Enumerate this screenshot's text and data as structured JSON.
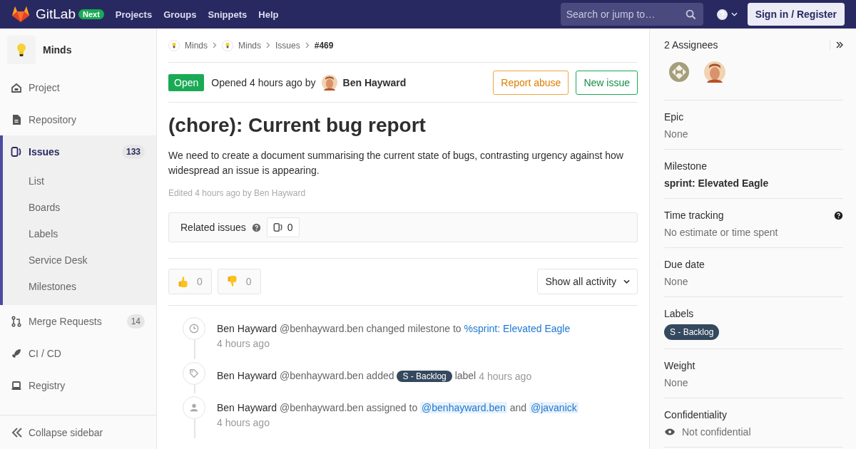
{
  "navbar": {
    "brand": "GitLab",
    "badge": "Next",
    "links": [
      "Projects",
      "Groups",
      "Snippets",
      "Help"
    ],
    "search": {
      "placeholder": "Search or jump to…"
    },
    "sign_in": "Sign in / Register"
  },
  "sidebar": {
    "project": "Minds",
    "items": [
      {
        "label": "Project",
        "selected": false
      },
      {
        "label": "Repository",
        "selected": false
      },
      {
        "label": "Issues",
        "count": "133",
        "selected": true,
        "children": [
          {
            "label": "List",
            "selected": false
          },
          {
            "label": "Boards",
            "selected": false
          },
          {
            "label": "Labels",
            "selected": false
          },
          {
            "label": "Service Desk",
            "selected": false
          },
          {
            "label": "Milestones",
            "selected": false
          }
        ]
      },
      {
        "label": "Merge Requests",
        "count": "14",
        "selected": false
      },
      {
        "label": "CI / CD",
        "selected": false
      },
      {
        "label": "Registry",
        "selected": false
      }
    ],
    "collapse": "Collapse sidebar"
  },
  "breadcrumbs": [
    {
      "text": "Minds",
      "kind": "project"
    },
    {
      "text": "Minds",
      "kind": "project"
    },
    {
      "text": "Issues",
      "kind": "link"
    },
    {
      "text": "#469",
      "kind": "current"
    }
  ],
  "issue": {
    "status": "Open",
    "opened": "Opened 4 hours ago by",
    "author": "Ben Hayward",
    "buttons": [
      {
        "label": "Report abuse",
        "kind": "warning"
      },
      {
        "label": "New issue",
        "kind": "success"
      }
    ],
    "title": "(chore): Current bug report",
    "description": "We need to create a document summarising the current state of bugs, contrasting urgency against how widespread an issue is appearing.",
    "edited": "Edited 4 hours ago by Ben Hayward",
    "related": {
      "label": "Related issues",
      "count": "0"
    },
    "awards": [
      {
        "kind": "thumbsup",
        "count": "0"
      },
      {
        "kind": "thumbsdown",
        "count": "0"
      }
    ],
    "activity_filter": "Show all activity"
  },
  "activity": [
    {
      "kind": "milestone",
      "author": "Ben Hayward",
      "handle": "@benhayward.ben",
      "action": "changed milestone to",
      "link": "%sprint: Elevated Eagle",
      "time": "4 hours ago"
    },
    {
      "kind": "label",
      "author": "Ben Hayward",
      "handle": "@benhayward.ben",
      "action": "added",
      "label": "S - Backlog",
      "suffix": "label",
      "time": "4 hours ago"
    },
    {
      "kind": "assign",
      "author": "Ben Hayward",
      "handle": "@benhayward.ben",
      "action": "assigned to",
      "mentions": [
        "@benhayward.ben",
        "@javanick"
      ],
      "joiner": "and",
      "time": "4 hours ago"
    }
  ],
  "right_sidebar": {
    "assignees_title": "2 Assignees",
    "sections": [
      {
        "title": "Epic",
        "value": "None",
        "kind": "muted"
      },
      {
        "title": "Milestone",
        "value": "sprint: Elevated Eagle",
        "kind": "strong"
      },
      {
        "title": "Time tracking",
        "value": "No estimate or time spent",
        "kind": "muted",
        "help": true
      },
      {
        "title": "Due date",
        "value": "None",
        "kind": "muted"
      },
      {
        "title": "Labels",
        "value": "S - Backlog",
        "kind": "label"
      },
      {
        "title": "Weight",
        "value": "None",
        "kind": "muted"
      },
      {
        "title": "Confidentiality",
        "value": "Not confidential",
        "kind": "eye"
      }
    ]
  }
}
